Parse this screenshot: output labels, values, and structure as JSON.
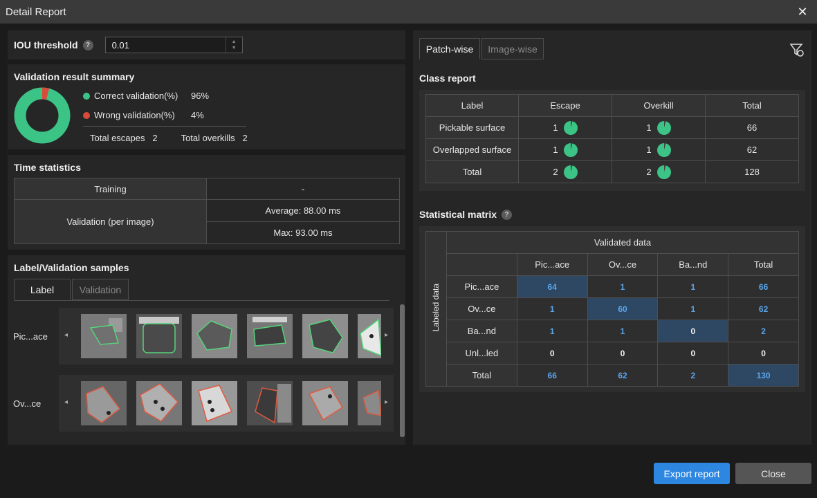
{
  "window": {
    "title": "Detail Report",
    "close_glyph": "✕"
  },
  "iou": {
    "label": "IOU threshold",
    "help": "?",
    "value": "0.01"
  },
  "summary": {
    "title": "Validation result summary",
    "correct_label": "Correct validation(%)",
    "correct_value": "96%",
    "wrong_label": "Wrong validation(%)",
    "wrong_value": "4%",
    "correct_fraction": 0.96,
    "colors": {
      "correct": "#3cc486",
      "wrong": "#d84b3a"
    },
    "escapes_label": "Total escapes",
    "escapes_value": "2",
    "overkills_label": "Total overkills",
    "overkills_value": "2"
  },
  "time": {
    "title": "Time statistics",
    "training_label": "Training",
    "training_value": "-",
    "validation_label": "Validation (per image)",
    "average": "Average: 88.00 ms",
    "max": "Max: 93.00 ms"
  },
  "samples": {
    "title": "Label/Validation samples",
    "tabs": [
      "Label",
      "Validation"
    ],
    "rows": [
      "Pic...ace",
      "Ov...ce"
    ],
    "prev_glyph": "◂",
    "next_glyph": "▸"
  },
  "right": {
    "tabs": [
      "Patch-wise",
      "Image-wise"
    ],
    "class_report": {
      "title": "Class report",
      "headers": [
        "Label",
        "Escape",
        "Overkill",
        "Total"
      ],
      "rows": [
        {
          "label": "Pickable surface",
          "escape": "1",
          "overkill": "1",
          "total": "66"
        },
        {
          "label": "Overlapped surface",
          "escape": "1",
          "overkill": "1",
          "total": "62"
        },
        {
          "label": "Total",
          "escape": "2",
          "overkill": "2",
          "total": "128"
        }
      ],
      "pie_color": "#3cc486"
    },
    "matrix": {
      "title": "Statistical matrix",
      "help": "?",
      "validated_label": "Validated data",
      "labeled_label": "Labeled data",
      "col_headers": [
        "Pic...ace",
        "Ov...ce",
        "Ba...nd",
        "Total"
      ],
      "row_headers": [
        "Pic...ace",
        "Ov...ce",
        "Ba...nd",
        "Unl...led",
        "Total"
      ],
      "cells": [
        [
          "64",
          "1",
          "1",
          "66"
        ],
        [
          "1",
          "60",
          "1",
          "62"
        ],
        [
          "1",
          "1",
          "0",
          "2"
        ],
        [
          "0",
          "0",
          "0",
          "0"
        ],
        [
          "66",
          "62",
          "2",
          "130"
        ]
      ]
    }
  },
  "footer": {
    "export": "Export report",
    "close": "Close"
  }
}
